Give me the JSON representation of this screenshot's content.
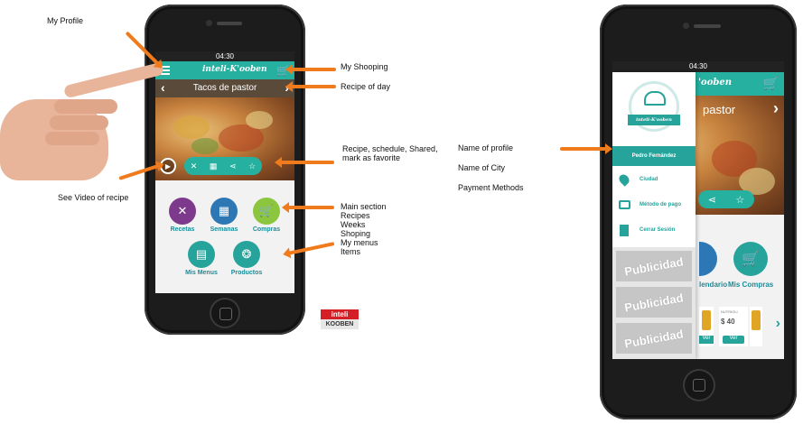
{
  "annotations": {
    "my_profile": "My Profile",
    "my_shopping": "My Shooping",
    "recipe_of_day": "Recipe of day",
    "recipe_actions": "Recipe, schedule, Shared,\nmark as favorite",
    "see_video": "See Video of recipe",
    "main_section": "Main section\nRecipes\nWeeks\nShoping\nMy menus\nItems",
    "name_of_profile": "Name of profile",
    "name_of_city": "Name of City",
    "payment_methods": "Payment Methods"
  },
  "left_phone": {
    "time": "04:30",
    "logo": "inteli-K'ooben",
    "recipe_title": "Tacos de pastor",
    "menu": [
      {
        "label": "Recetas",
        "color": "#7d3a8c"
      },
      {
        "label": "Semanas",
        "color": "#2e77b5"
      },
      {
        "label": "Compras",
        "color": "#8cc63f"
      },
      {
        "label": "Mis Menus",
        "color": "#26a39b"
      },
      {
        "label": "Productos",
        "color": "#26a39b"
      }
    ]
  },
  "brand_badge": {
    "top": "inteli",
    "bottom": "KOOBEN"
  },
  "right_phone": {
    "time": "04:30",
    "logo_partial": "'ooben",
    "recipe_partial": "pastor",
    "drawer": {
      "logo": "inteli-K'ooben",
      "profile_name": "Pedro Fernández",
      "items": [
        "Ciudad",
        "Método de pago",
        "Cerrar Sesión"
      ],
      "ads": [
        "Publicidad",
        "Publicidad",
        "Publicidad"
      ]
    },
    "menu_partial_left": "lendario",
    "menu_compras": "Mis Compras",
    "product_price": "$ 40",
    "product_button": "Ver",
    "product_button_2": "Ver",
    "product_brand": "NUTRIOLI"
  },
  "colors": {
    "teal": "#26b0a0",
    "arrow": "#f07b1c"
  }
}
